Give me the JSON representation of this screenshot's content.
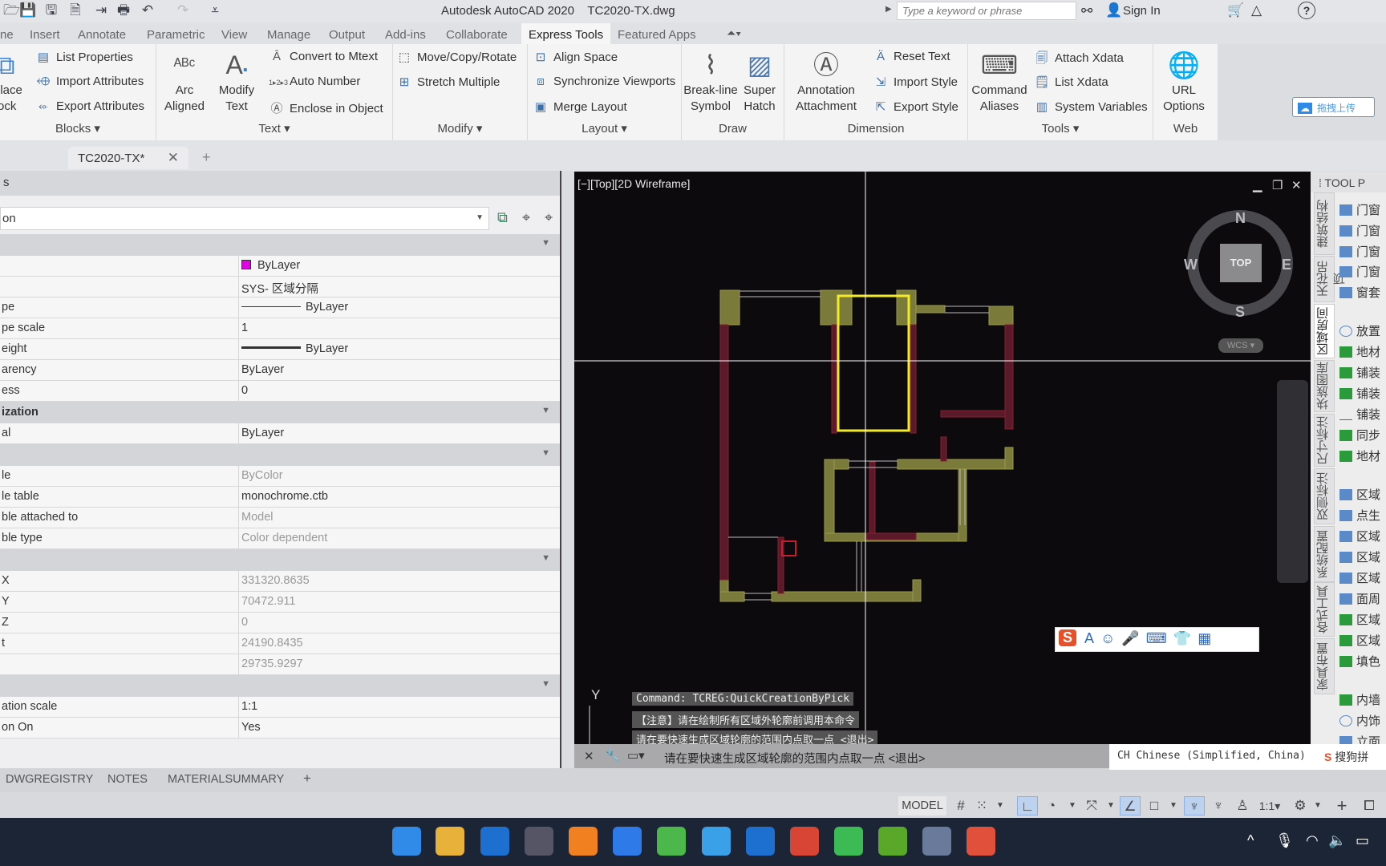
{
  "title_bar": {
    "title": "Autodesk AutoCAD 2020    TC2020-TX.dwg",
    "search_placeholder": "Type a keyword or phrase",
    "sign_in": "Sign In",
    "qat_icons": [
      "open-icon",
      "save-icon",
      "save-as-icon",
      "export-icon",
      "publish-icon",
      "print-icon",
      "undo-icon",
      "redo-icon",
      "customize-icon"
    ]
  },
  "ribbon_tabs": [
    "ne",
    "Insert",
    "Annotate",
    "Parametric",
    "View",
    "Manage",
    "Output",
    "Add-ins",
    "Collaborate",
    "Express Tools",
    "Featured Apps"
  ],
  "active_tab": "Express Tools",
  "ribbon": {
    "blocks": {
      "title": "Blocks",
      "replace": "place\nlock",
      "list_properties": "List Properties",
      "import_attributes": "Import Attributes",
      "export_attributes": "Export Attributes"
    },
    "text": {
      "title": "Text",
      "arc_aligned": "Arc\nAligned",
      "modify_text": "Modify\nText",
      "convert_mtext": "Convert to Mtext",
      "auto_number": "Auto Number",
      "enclose": "Enclose in Object"
    },
    "modify": {
      "title": "Modify",
      "move_copy_rotate": "Move/Copy/Rotate",
      "stretch_multiple": "Stretch Multiple"
    },
    "layout": {
      "title": "Layout",
      "align_space": "Align Space",
      "sync_viewports": "Synchronize Viewports",
      "merge_layout": "Merge Layout"
    },
    "draw": {
      "title": "Draw",
      "break_line": "Break-line\nSymbol",
      "super_hatch": "Super\nHatch"
    },
    "dimension": {
      "title": "Dimension",
      "annotation_attachment": "Annotation\nAttachment",
      "reset_text": "Reset Text",
      "import_style": "Import Style",
      "export_style": "Export Style"
    },
    "tools": {
      "title": "Tools",
      "command_aliases": "Command\nAliases",
      "attach_xdata": "Attach Xdata",
      "list_xdata": "List Xdata",
      "system_variables": "System Variables"
    },
    "web": {
      "title": "Web",
      "url_options": "URL\nOptions"
    },
    "upload_button": "拖拽上传"
  },
  "doc_tab": {
    "label": "TC2020-TX*"
  },
  "properties": {
    "header": "s",
    "selection": "on",
    "rows": [
      {
        "type": "cat",
        "label": ""
      },
      {
        "k": "",
        "v": "ByLayer",
        "swatch": "#e400e4"
      },
      {
        "k": "",
        "v": "SYS- 区域分隔"
      },
      {
        "k": "pe",
        "v": "ByLayer",
        "line": "thin"
      },
      {
        "k": "pe scale",
        "v": "1"
      },
      {
        "k": "eight",
        "v": "ByLayer",
        "line": "thick"
      },
      {
        "k": "arency",
        "v": "ByLayer"
      },
      {
        "k": "ess",
        "v": "0"
      },
      {
        "type": "cat",
        "label": "ization"
      },
      {
        "k": "al",
        "v": "ByLayer"
      },
      {
        "type": "cat",
        "label": ""
      },
      {
        "k": "le",
        "v": "ByColor",
        "dim": true
      },
      {
        "k": "le table",
        "v": "monochrome.ctb"
      },
      {
        "k": "ble attached to",
        "v": "Model",
        "dim": true
      },
      {
        "k": "ble type",
        "v": "Color dependent",
        "dim": true
      },
      {
        "type": "cat",
        "label": ""
      },
      {
        "k": "X",
        "v": "331320.8635",
        "dim": true
      },
      {
        "k": "Y",
        "v": "70472.911",
        "dim": true
      },
      {
        "k": "Z",
        "v": "0",
        "dim": true
      },
      {
        "k": "t",
        "v": "24190.8435",
        "dim": true
      },
      {
        "k": "",
        "v": "29735.9297",
        "dim": true
      },
      {
        "type": "cat",
        "label": ""
      },
      {
        "k": "ation scale",
        "v": "1:1"
      },
      {
        "k": "on On",
        "v": "Yes"
      }
    ]
  },
  "viewport": {
    "label": "[−][Top][2D Wireframe]",
    "viewcube": {
      "n": "N",
      "s": "S",
      "e": "E",
      "w": "W",
      "top": "TOP",
      "wcs": "WCS"
    },
    "ucs_y": "Y",
    "command_history": [
      "Command: TCREG:QuickCreationByPick",
      "【注意】请在绘制所有区域外轮廓前调用本命令",
      "请在要快速生成区域轮廓的范围内点取一点 <退出>"
    ],
    "selected_color": "#f2ea2a"
  },
  "command_line": {
    "prompt": "请在要快速生成区域轮廓的范围内点取一点 <退出>"
  },
  "ime": {
    "language": "CH Chinese (Simplified, China)",
    "sogou": "搜狗拼"
  },
  "tool_palette": {
    "header": "TOOL P",
    "vertical_tabs": [
      "建筑结构",
      "天花吊顶",
      "区域房间",
      "块族图库",
      "尺寸标注",
      "双侧标注",
      "系统配置",
      "各式工具",
      "家具布置"
    ],
    "active_tab": "区域房间",
    "items": [
      "门窗",
      "门窗",
      "门窗",
      "门窗",
      "窗套",
      "放置",
      "地材",
      "铺装",
      "铺装",
      "铺装",
      "同步",
      "地材",
      "区域",
      "点生",
      "区域",
      "区域",
      "区域",
      "面周",
      "区域",
      "区域",
      "填色",
      "内墙",
      "内饰",
      "立面"
    ]
  },
  "layout_tabs": [
    "DWGREGISTRY",
    "NOTES",
    "MATERIALSUMMARY",
    "+"
  ],
  "status_bar": {
    "model": "MODEL",
    "scale": "1:1"
  },
  "taskbar": {
    "apps": [
      "start",
      "file-explorer",
      "app-blue",
      "tool",
      "search",
      "feishu",
      "clover",
      "notepad",
      "app-blue-2",
      "chrome",
      "wechat",
      "camtasia-green",
      "cad-assistant",
      "camtasia-red"
    ]
  }
}
